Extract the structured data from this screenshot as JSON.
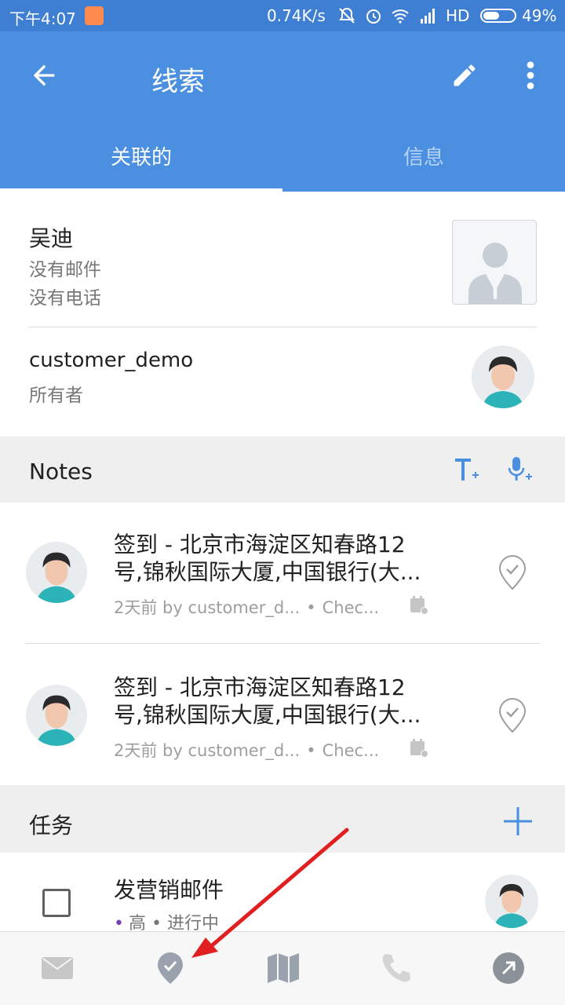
{
  "status_bar": {
    "time": "下午4:07",
    "speed": "0.74K/s",
    "network": "HD",
    "battery": "49%"
  },
  "app_bar": {
    "title": "线索",
    "tabs": [
      "关联的",
      "信息"
    ],
    "active_tab": 0
  },
  "contact": {
    "name": "吴迪",
    "email": "没有邮件",
    "phone": "没有电话"
  },
  "owner": {
    "name": "customer_demo",
    "label": "所有者"
  },
  "notes": {
    "header": "Notes",
    "items": [
      {
        "line1": "签到 - 北京市海淀区知春路12",
        "line2": "号,锦秋国际大厦,中国银行(大...",
        "author": "2天前 by customer_d...",
        "type": "Chec..."
      },
      {
        "line1": "签到 - 北京市海淀区知春路12",
        "line2": "号,锦秋国际大厦,中国银行(大...",
        "author": "2天前 by customer_d...",
        "type": "Chec..."
      }
    ]
  },
  "tasks": {
    "header": "任务",
    "items": [
      {
        "title": "发营销邮件",
        "priority": "高",
        "status": "进行中"
      }
    ]
  },
  "colors": {
    "primary": "#4a8fe0",
    "status_bar": "#3f7fd3",
    "accent_icon": "#4a8fe0",
    "annotation_arrow": "#e02020"
  },
  "bottom_bar": {
    "icons": [
      "mail-icon",
      "checkin-icon",
      "map-icon",
      "phone-icon",
      "share-icon"
    ]
  }
}
